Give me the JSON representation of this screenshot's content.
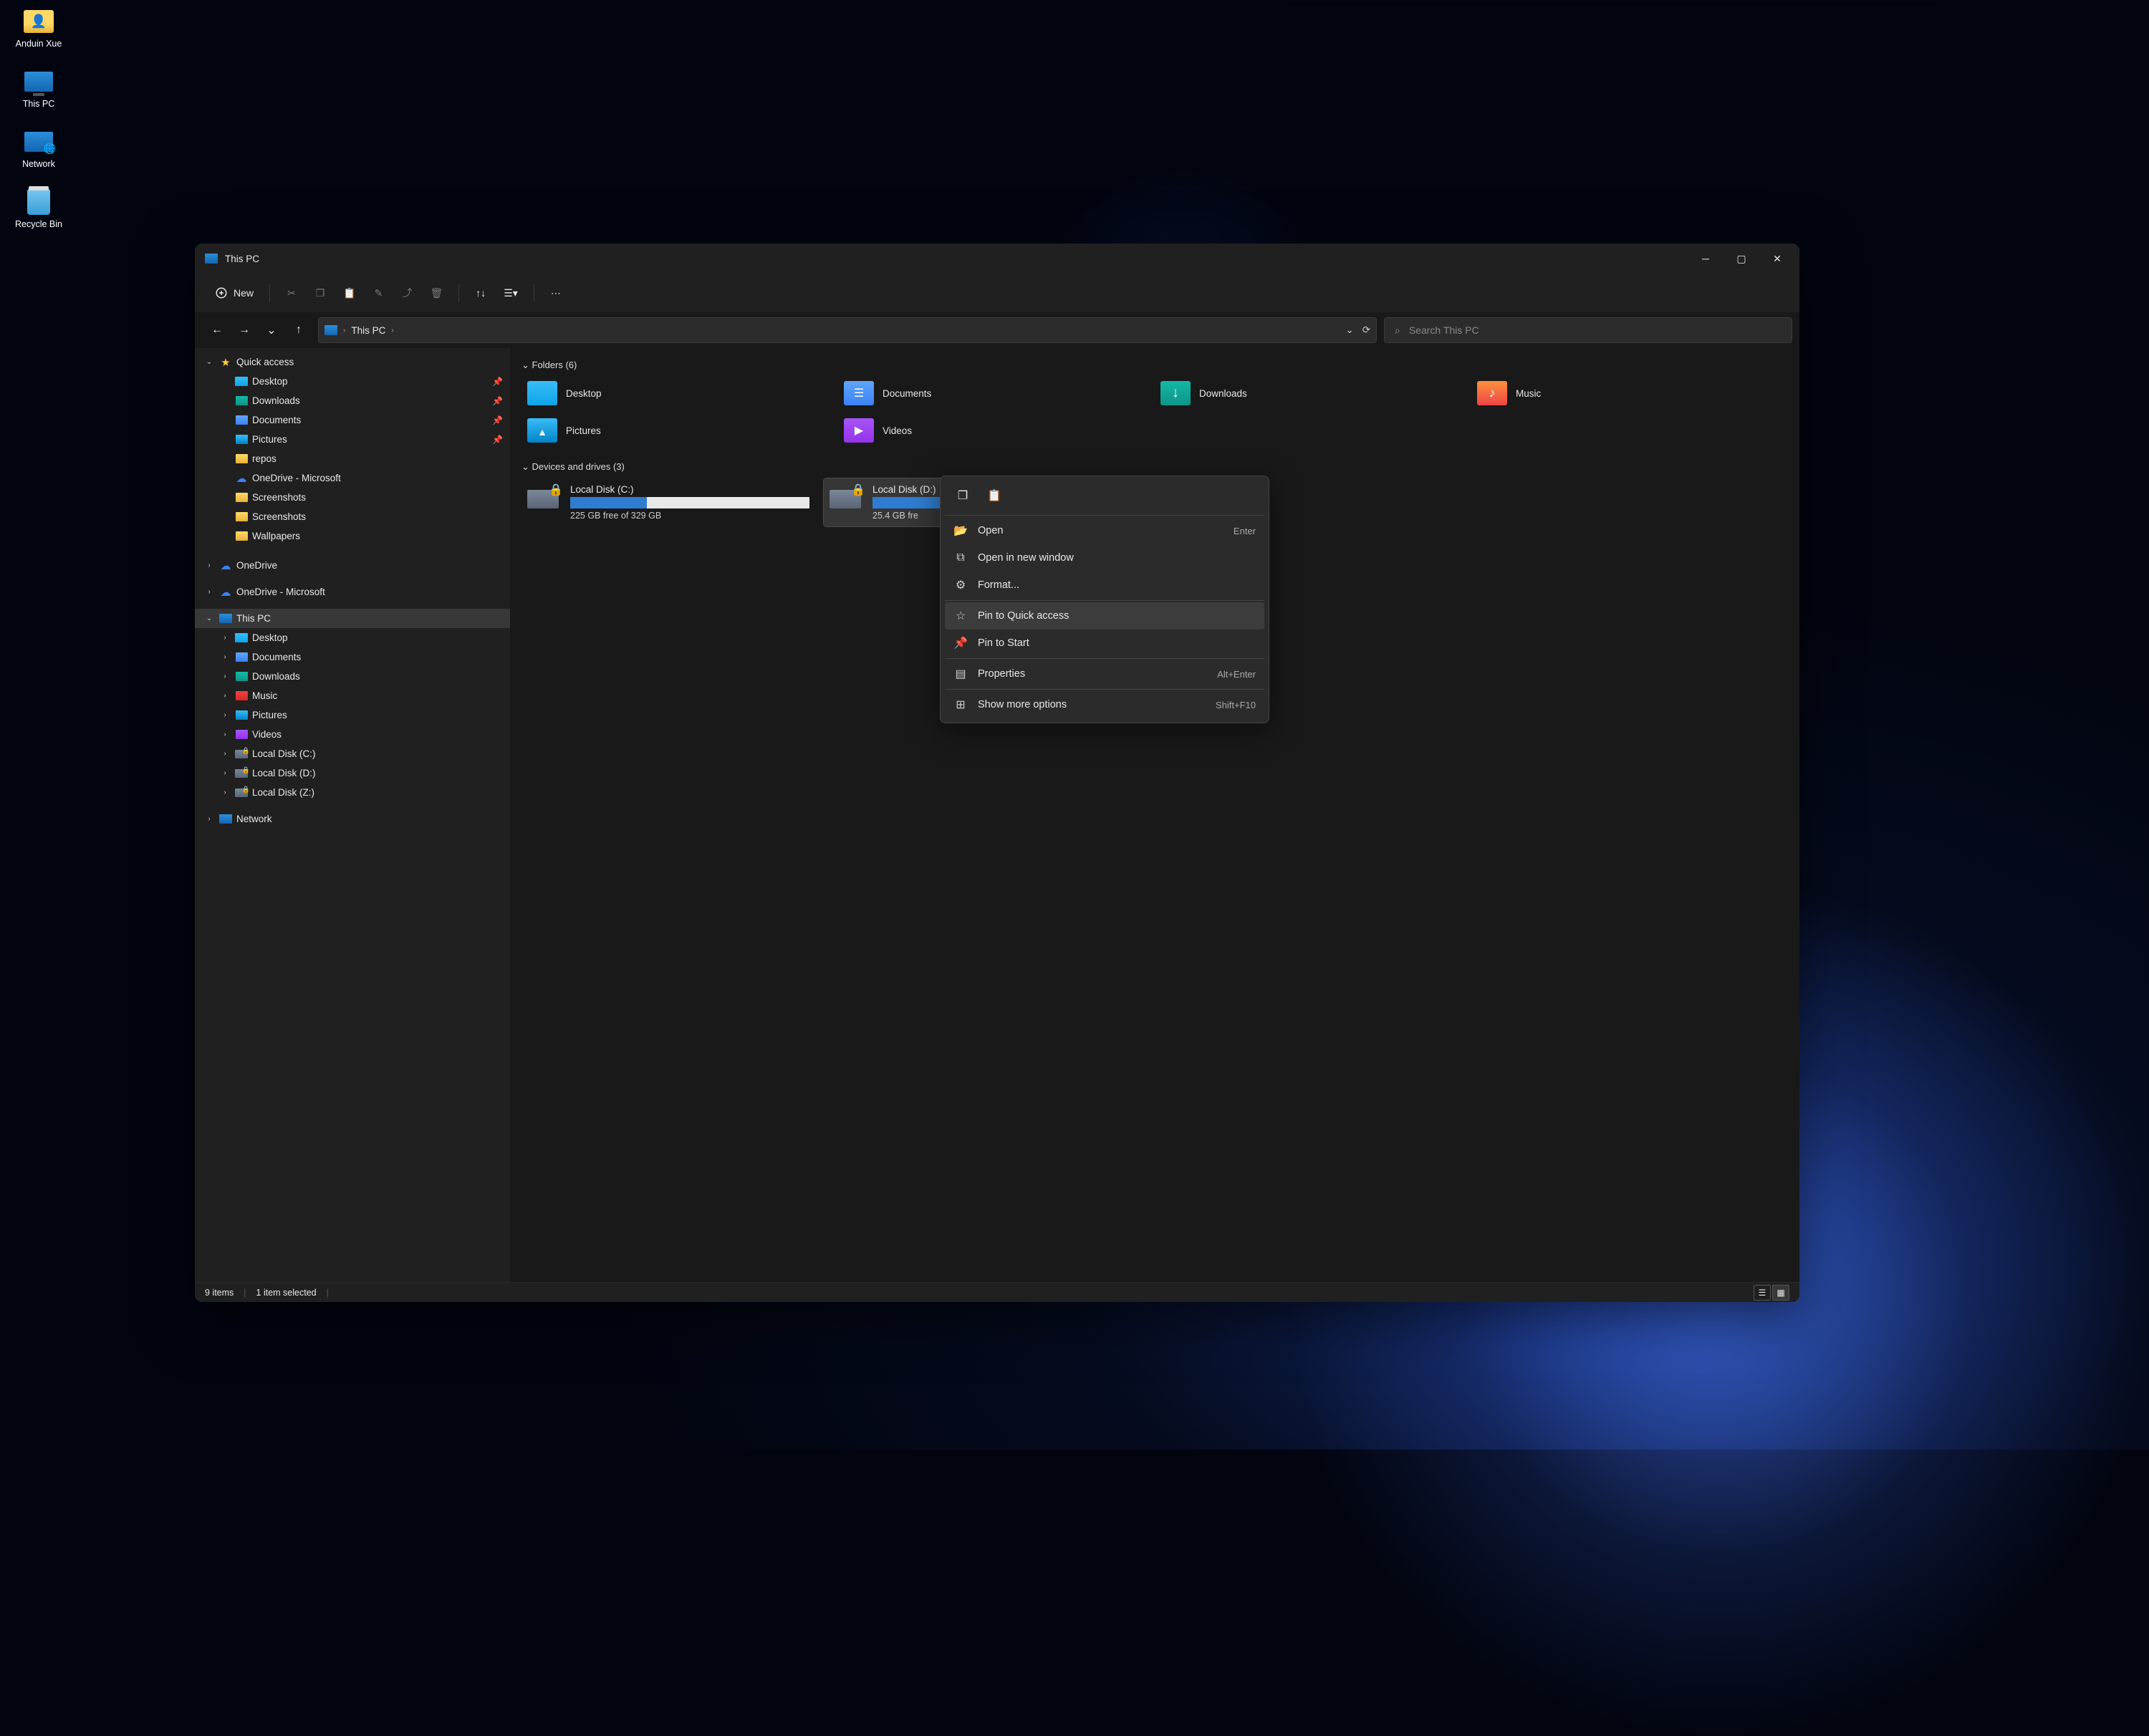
{
  "desktop": {
    "icons": [
      "Anduin Xue",
      "This PC",
      "Network",
      "Recycle Bin"
    ]
  },
  "window": {
    "title": "This PC",
    "toolbar": {
      "new": "New"
    },
    "breadcrumb": "This PC",
    "search_placeholder": "Search This PC",
    "sidebar": {
      "quick": "Quick access",
      "qa_items": [
        {
          "label": "Desktop",
          "cls": "fc-desk",
          "pin": true
        },
        {
          "label": "Downloads",
          "cls": "fc-down",
          "pin": true
        },
        {
          "label": "Documents",
          "cls": "fc-doc",
          "pin": true
        },
        {
          "label": "Pictures",
          "cls": "fc-pic",
          "pin": true
        },
        {
          "label": "repos",
          "cls": "fc-folder",
          "pin": false
        },
        {
          "label": "OneDrive - Microsoft",
          "cls": "fc-cloud",
          "pin": false
        },
        {
          "label": "Screenshots",
          "cls": "fc-folder",
          "pin": false
        },
        {
          "label": "Screenshots",
          "cls": "fc-folder",
          "pin": false
        },
        {
          "label": "Wallpapers",
          "cls": "fc-folder",
          "pin": false
        }
      ],
      "onedrive": "OneDrive",
      "onedrive_ms": "OneDrive - Microsoft",
      "thispc": "This PC",
      "pc_items": [
        {
          "label": "Desktop",
          "cls": "fc-desk"
        },
        {
          "label": "Documents",
          "cls": "fc-doc"
        },
        {
          "label": "Downloads",
          "cls": "fc-down"
        },
        {
          "label": "Music",
          "cls": "fc-music"
        },
        {
          "label": "Pictures",
          "cls": "fc-pic"
        },
        {
          "label": "Videos",
          "cls": "fc-vid"
        },
        {
          "label": "Local Disk (C:)",
          "cls": "fc-drive-lock"
        },
        {
          "label": "Local Disk (D:)",
          "cls": "fc-drive-lock"
        },
        {
          "label": "Local Disk (Z:)",
          "cls": "fc-drive-lock"
        }
      ],
      "network": "Network"
    },
    "sections": {
      "folders": "Folders (6)",
      "drives": "Devices and drives (3)"
    },
    "folders": [
      {
        "label": "Desktop",
        "cls": "bf-desk"
      },
      {
        "label": "Documents",
        "cls": "bf-doc"
      },
      {
        "label": "Downloads",
        "cls": "bf-down"
      },
      {
        "label": "Music",
        "cls": "bf-music"
      },
      {
        "label": "Pictures",
        "cls": "bf-pic"
      },
      {
        "label": "Videos",
        "cls": "bf-vid"
      }
    ],
    "drives": [
      {
        "name": "Local Disk (C:)",
        "free": "225 GB free of 329 GB",
        "fill": 32,
        "lock": "blue",
        "bar": true,
        "sel": false
      },
      {
        "name": "Local Disk (D:)",
        "free": "25.4 GB fre",
        "fill": 60,
        "lock": "blue",
        "bar": true,
        "sel": true
      },
      {
        "name": "Local Disk (Z:)",
        "free": "",
        "fill": 0,
        "lock": "yellow",
        "bar": false,
        "sel": false
      }
    ],
    "context_menu": [
      {
        "icon": "📂",
        "label": "Open",
        "shortcut": "Enter",
        "iclass": "yellow"
      },
      {
        "icon": "⧉",
        "label": "Open in new window",
        "shortcut": ""
      },
      {
        "icon": "⚙",
        "label": "Format...",
        "shortcut": ""
      },
      {
        "sep": true
      },
      {
        "icon": "☆",
        "label": "Pin to Quick access",
        "shortcut": "",
        "hilite": true
      },
      {
        "icon": "📌",
        "label": "Pin to Start",
        "shortcut": ""
      },
      {
        "sep": true
      },
      {
        "icon": "▤",
        "label": "Properties",
        "shortcut": "Alt+Enter"
      },
      {
        "sep": true
      },
      {
        "icon": "⊞",
        "label": "Show more options",
        "shortcut": "Shift+F10"
      }
    ],
    "status": {
      "items": "9 items",
      "selected": "1 item selected"
    }
  }
}
